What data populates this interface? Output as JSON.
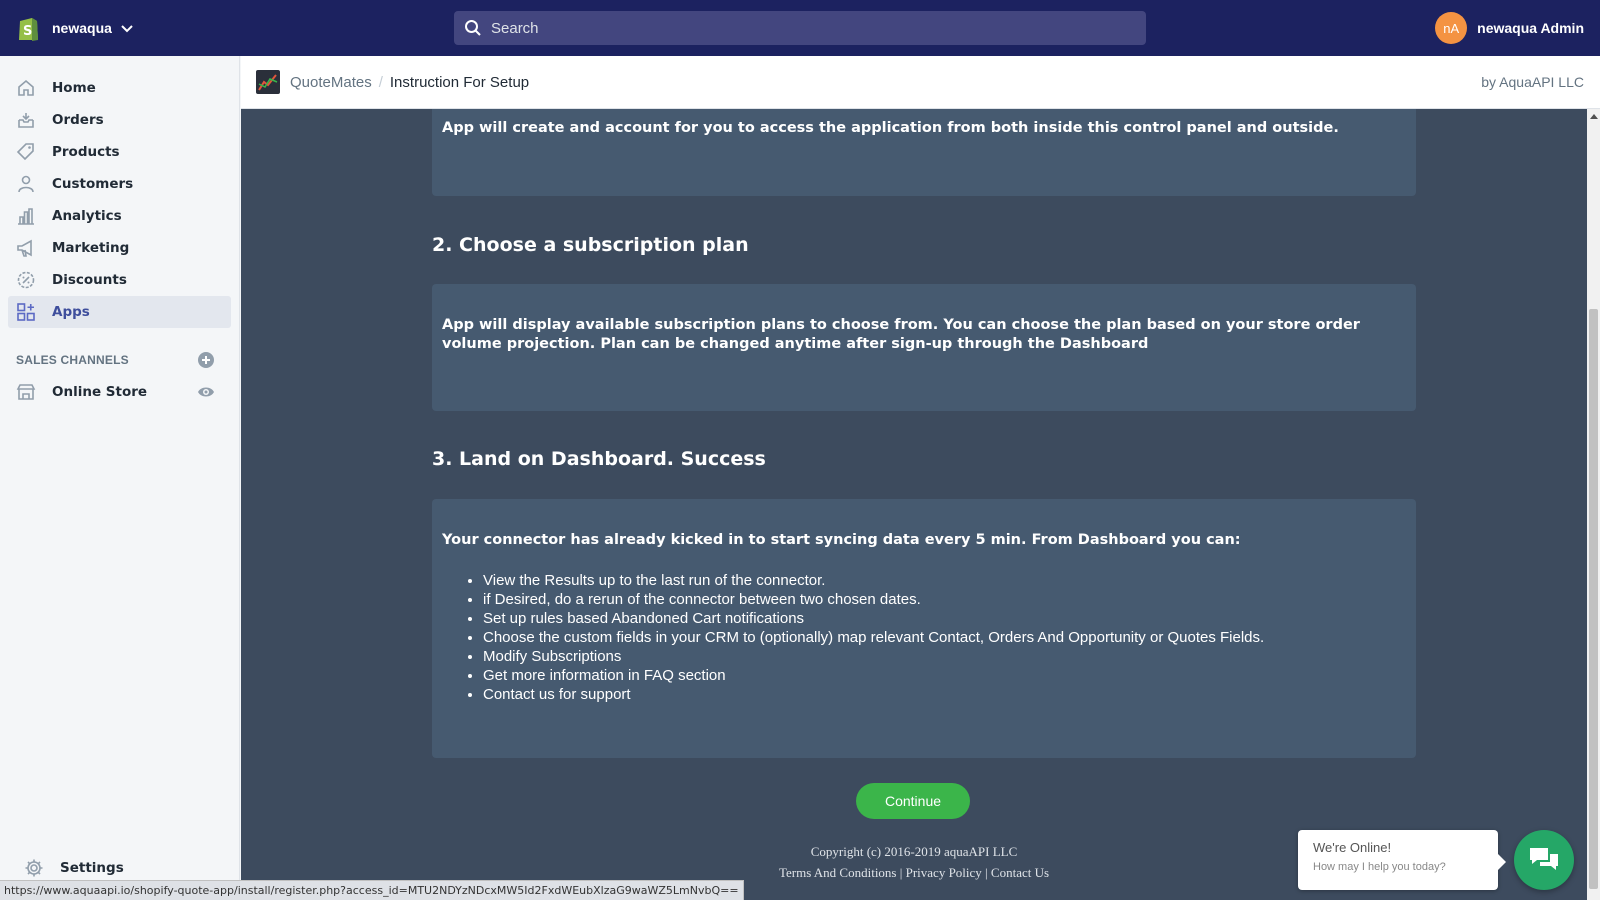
{
  "topbar": {
    "store_name": "newaqua",
    "search_placeholder": "Search",
    "avatar_initials": "nA",
    "user_name": "newaqua Admin"
  },
  "sidebar": {
    "items": [
      {
        "label": "Home",
        "icon": "home-icon"
      },
      {
        "label": "Orders",
        "icon": "orders-icon"
      },
      {
        "label": "Products",
        "icon": "tag-icon"
      },
      {
        "label": "Customers",
        "icon": "person-icon"
      },
      {
        "label": "Analytics",
        "icon": "bar-chart-icon"
      },
      {
        "label": "Marketing",
        "icon": "megaphone-icon"
      },
      {
        "label": "Discounts",
        "icon": "discount-icon"
      },
      {
        "label": "Apps",
        "icon": "apps-icon",
        "active": true
      }
    ],
    "sales_channels_label": "SALES CHANNELS",
    "online_store_label": "Online Store",
    "settings_label": "Settings"
  },
  "apphead": {
    "app_name": "QuoteMates",
    "separator": "/",
    "page_title": "Instruction For Setup",
    "by_line": "by AquaAPI LLC"
  },
  "content": {
    "step1_text": "App will create and account for you to access the application from both inside this control panel and outside.",
    "step2_heading": "2. Choose a subscription plan",
    "step2_text": "App will display available subscription plans to choose from. You can choose the plan based on your store order volume projection. Plan can be changed anytime after sign-up through the Dashboard",
    "step3_heading": "3. Land on Dashboard. Success",
    "step3_intro": "Your connector has already kicked in to start syncing data every 5 min. From Dashboard you can:",
    "step3_bullets": [
      "View the Results up to the last run of the connector.",
      "if Desired, do a rerun of the connector between two chosen dates.",
      "Set up rules based Abandoned Cart notifications",
      "Choose the custom fields in your CRM to (optionally) map relevant Contact, Orders And Opportunity or Quotes Fields.",
      "Modify Subscriptions",
      "Get more information in FAQ section",
      "Contact us for support"
    ],
    "continue_label": "Continue",
    "copyright": "Copyright (c) 2016-2019 aquaAPI LLC",
    "footer_links": {
      "terms": "Terms And Conditions",
      "privacy": "Privacy Policy",
      "contact": "Contact Us",
      "divider": "|"
    }
  },
  "chat": {
    "title": "We're Online!",
    "subtitle": "How may I help you today?"
  },
  "statusbar_url": "https://www.aquaapi.io/shopify-quote-app/install/register.php?access_id=MTU2NDYzNDcxMW5Id2FxdWEubXlzaG9waWZ5LmNvbQ==",
  "colors": {
    "topbar": "#1c2260",
    "content_bg": "#3d4b5e",
    "card_bg": "#465a70",
    "continue_button": "#3bb54a",
    "chat_button": "#25a767",
    "avatar": "#f49342"
  }
}
